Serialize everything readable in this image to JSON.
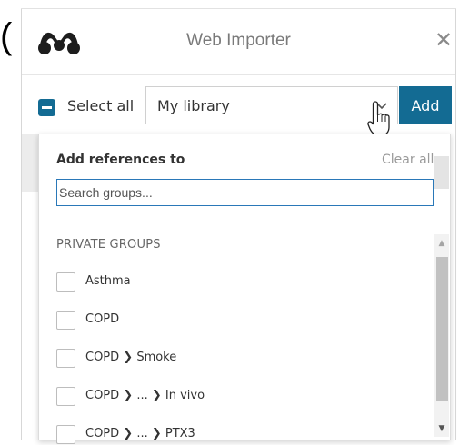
{
  "header": {
    "title": "Web Importer",
    "close_glyph": "✕",
    "logo_icon": "mendeley-logo-icon"
  },
  "background": {
    "peek_text": "("
  },
  "toolbar": {
    "select_all_label": "Select all",
    "library_value": "My library",
    "add_label": "Add"
  },
  "dropdown": {
    "heading": "Add references to",
    "clear_all": "Clear all",
    "search_placeholder": "Search groups...",
    "section_title": "PRIVATE GROUPS",
    "items": [
      {
        "label": "Asthma"
      },
      {
        "label": "COPD"
      },
      {
        "label": "COPD ❯ Smoke"
      },
      {
        "label": "COPD ❯ ... ❯ In vivo"
      },
      {
        "label": "COPD ❯ ... ❯ PTX3"
      }
    ]
  },
  "colors": {
    "accent": "#136b93",
    "focus_border": "#2a78b8"
  }
}
